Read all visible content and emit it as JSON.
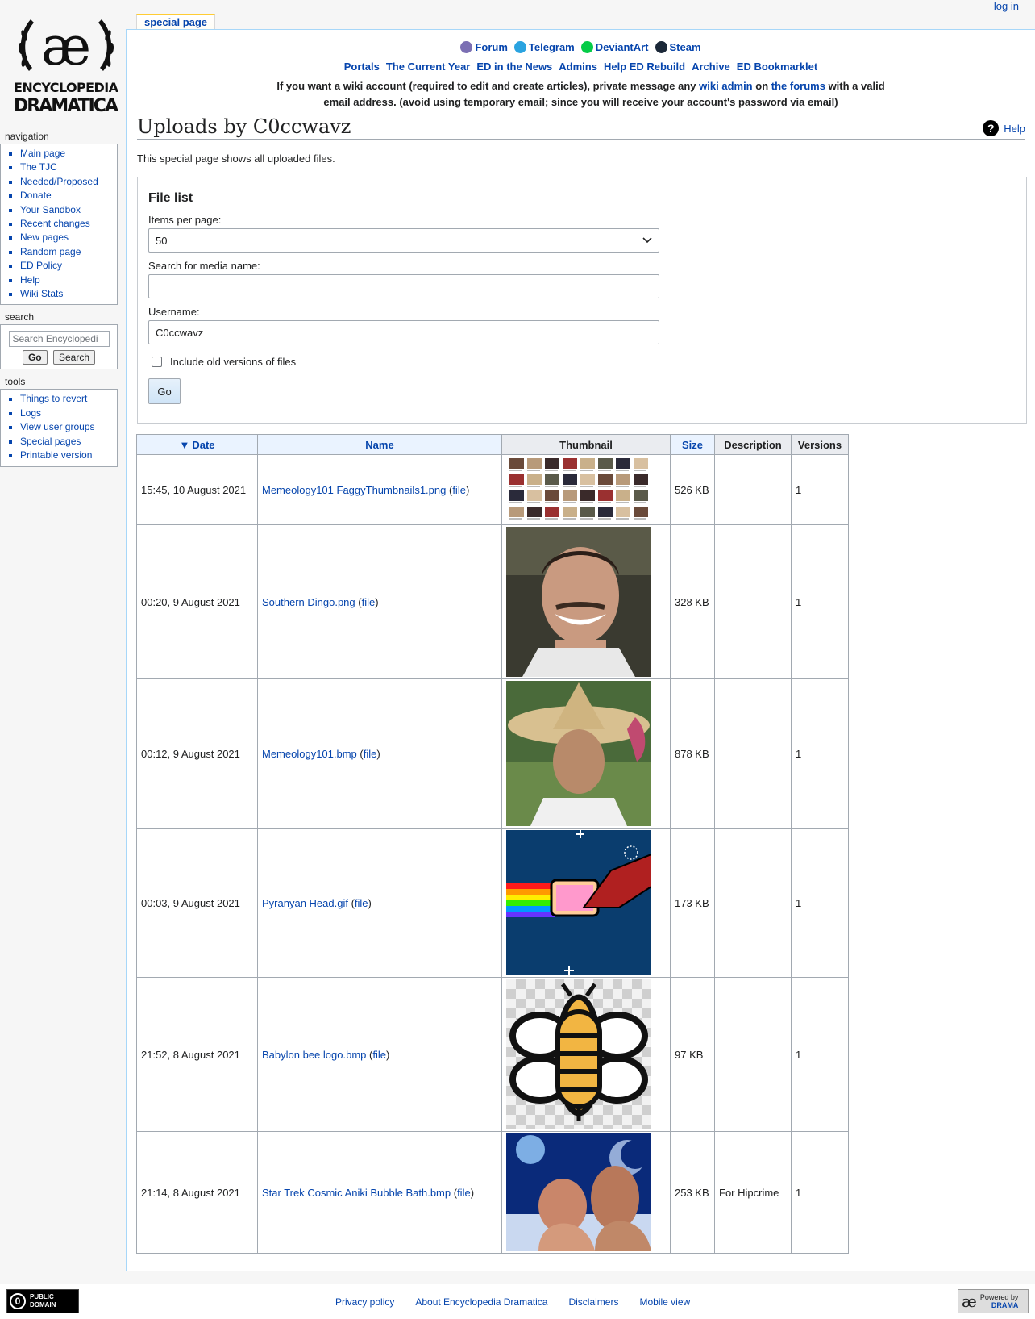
{
  "logo": {
    "glyph": "æ",
    "line1": "ENCYCLOPEDIA",
    "line2": "DRAMATICA"
  },
  "personal": {
    "login": "log in"
  },
  "tabs": {
    "special_page": "special page"
  },
  "sitenotice": {
    "social": [
      {
        "label": "Forum",
        "icon": "forum-icon",
        "color": "#7b6fb3"
      },
      {
        "label": "Telegram",
        "icon": "telegram-icon",
        "color": "#2aa3e0"
      },
      {
        "label": "DeviantArt",
        "icon": "deviantart-icon",
        "color": "#05cc47"
      },
      {
        "label": "Steam",
        "icon": "steam-icon",
        "color": "#1b2838"
      }
    ],
    "links": [
      "Portals",
      "The Current Year",
      "ED in the News",
      "Admins",
      "Help ED Rebuild",
      "Archive",
      "ED Bookmarklet"
    ],
    "notice_pre": "If you want a wiki account (required to edit and create articles), private message any",
    "notice_link1": "wiki admin",
    "notice_mid": "on",
    "notice_link2": "the forums",
    "notice_post": "with a valid email address. (avoid using temporary email; since you will receive your account's password via email)"
  },
  "page": {
    "title": "Uploads by C0ccwavz",
    "help": "Help",
    "help_icon": "?",
    "intro": "This special page shows all uploaded files."
  },
  "form": {
    "legend": "File list",
    "items_label": "Items per page:",
    "items_value": "50",
    "media_label": "Search for media name:",
    "media_value": "",
    "user_label": "Username:",
    "user_value": "C0ccwavz",
    "old_versions_label": "Include old versions of files",
    "go": "Go"
  },
  "table": {
    "headers": {
      "date": "Date",
      "name": "Name",
      "thumb": "Thumbnail",
      "size": "Size",
      "desc": "Description",
      "versions": "Versions"
    },
    "sort_arrow": "▼",
    "file_word": "file",
    "rows": [
      {
        "date": "15:45, 10 August 2021",
        "name": "Memeology101 FaggyThumbnails1.png",
        "size": "526 KB",
        "desc": "",
        "versions": "1"
      },
      {
        "date": "00:20, 9 August 2021",
        "name": "Southern Dingo.png",
        "size": "328 KB",
        "desc": "",
        "versions": "1"
      },
      {
        "date": "00:12, 9 August 2021",
        "name": "Memeology101.bmp",
        "size": "878 KB",
        "desc": "",
        "versions": "1"
      },
      {
        "date": "00:03, 9 August 2021",
        "name": "Pyranyan Head.gif",
        "size": "173 KB",
        "desc": "",
        "versions": "1"
      },
      {
        "date": "21:52, 8 August 2021",
        "name": "Babylon bee logo.bmp",
        "size": "97 KB",
        "desc": "",
        "versions": "1"
      },
      {
        "date": "21:14, 8 August 2021",
        "name": "Star Trek Cosmic Aniki Bubble Bath.bmp",
        "size": "253 KB",
        "desc": "For Hipcrime",
        "versions": "1"
      }
    ]
  },
  "sidebar": {
    "navigation": {
      "title": "navigation",
      "items": [
        "Main page",
        "The TJC",
        "Needed/Proposed",
        "Donate",
        "Your Sandbox",
        "Recent changes",
        "New pages",
        "Random page",
        "ED Policy",
        "Help",
        "Wiki Stats"
      ]
    },
    "search": {
      "title": "search",
      "placeholder": "Search Encyclopedi",
      "go": "Go",
      "search": "Search"
    },
    "tools": {
      "title": "tools",
      "items": [
        "Things to revert",
        "Logs",
        "View user groups",
        "Special pages",
        "Printable version"
      ]
    }
  },
  "footer": {
    "links": [
      "Privacy policy",
      "About Encyclopedia Dramatica",
      "Disclaimers",
      "Mobile view"
    ],
    "pd_line1": "PUBLIC",
    "pd_line2": "DOMAIN",
    "pd_glyph": "0",
    "powered_glyph": "æ",
    "powered_line1": "Powered by",
    "powered_line2": "DRAMA"
  }
}
